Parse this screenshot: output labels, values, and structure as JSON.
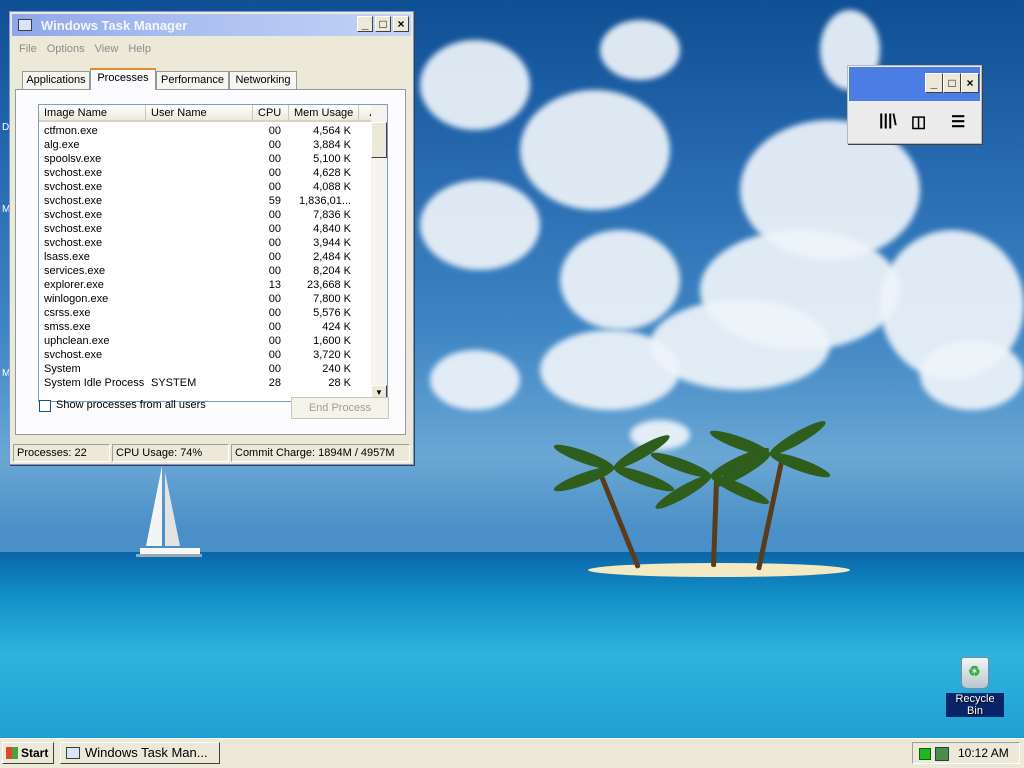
{
  "task_manager": {
    "title": "Windows Task Manager",
    "menu": [
      "File",
      "Options",
      "View",
      "Help"
    ],
    "tabs": [
      "Applications",
      "Processes",
      "Performance",
      "Networking"
    ],
    "active_tab": "Processes",
    "columns": [
      "Image Name",
      "User Name",
      "CPU",
      "Mem Usage"
    ],
    "processes": [
      {
        "image": "ctfmon.exe",
        "user": "",
        "cpu": "00",
        "mem": "4,564 K"
      },
      {
        "image": "alg.exe",
        "user": "",
        "cpu": "00",
        "mem": "3,884 K"
      },
      {
        "image": "spoolsv.exe",
        "user": "",
        "cpu": "00",
        "mem": "5,100 K"
      },
      {
        "image": "svchost.exe",
        "user": "",
        "cpu": "00",
        "mem": "4,628 K"
      },
      {
        "image": "svchost.exe",
        "user": "",
        "cpu": "00",
        "mem": "4,088 K"
      },
      {
        "image": "svchost.exe",
        "user": "",
        "cpu": "59",
        "mem": "1,836,01..."
      },
      {
        "image": "svchost.exe",
        "user": "",
        "cpu": "00",
        "mem": "7,836 K"
      },
      {
        "image": "svchost.exe",
        "user": "",
        "cpu": "00",
        "mem": "4,840 K"
      },
      {
        "image": "svchost.exe",
        "user": "",
        "cpu": "00",
        "mem": "3,944 K"
      },
      {
        "image": "lsass.exe",
        "user": "",
        "cpu": "00",
        "mem": "2,484 K"
      },
      {
        "image": "services.exe",
        "user": "",
        "cpu": "00",
        "mem": "8,204 K"
      },
      {
        "image": "explorer.exe",
        "user": "",
        "cpu": "13",
        "mem": "23,668 K"
      },
      {
        "image": "winlogon.exe",
        "user": "",
        "cpu": "00",
        "mem": "7,800 K"
      },
      {
        "image": "csrss.exe",
        "user": "",
        "cpu": "00",
        "mem": "5,576 K"
      },
      {
        "image": "smss.exe",
        "user": "",
        "cpu": "00",
        "mem": "424 K"
      },
      {
        "image": "uphclean.exe",
        "user": "",
        "cpu": "00",
        "mem": "1,600 K"
      },
      {
        "image": "svchost.exe",
        "user": "",
        "cpu": "00",
        "mem": "3,720 K"
      },
      {
        "image": "System",
        "user": "",
        "cpu": "00",
        "mem": "240 K"
      },
      {
        "image": "System Idle Process",
        "user": "SYSTEM",
        "cpu": "28",
        "mem": "28 K"
      }
    ],
    "show_all_label": "Show processes from all users",
    "show_all_checked": false,
    "end_process_label": "End Process",
    "status": {
      "processes": "Processes: 22",
      "cpu": "CPU Usage: 74%",
      "commit": "Commit Charge: 1894M / 4957M"
    }
  },
  "mini_window": {
    "controls": [
      "_",
      "□",
      "×"
    ],
    "tools": [
      "library-icon",
      "sidebar-icon",
      "menu-icon"
    ],
    "accent": "#4b7de4"
  },
  "desktop": {
    "recycle_bin_label": "Recycle Bin"
  },
  "taskbar": {
    "start_label": "Start",
    "task_button_label": "Windows Task Man...",
    "clock": "10:12 AM"
  }
}
